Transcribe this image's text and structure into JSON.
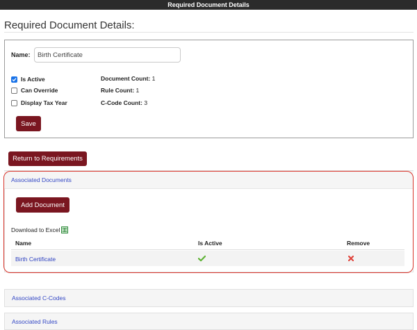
{
  "window": {
    "title": "Required Document Details"
  },
  "page": {
    "title": "Required Document Details:"
  },
  "form": {
    "name_label": "Name:",
    "name_value": "Birth Certificate",
    "checkboxes": [
      {
        "label": "Is Active",
        "checked": true
      },
      {
        "label": "Can Override",
        "checked": false
      },
      {
        "label": "Display Tax Year",
        "checked": false
      }
    ],
    "stats": [
      {
        "label": "Document Count:",
        "value": "1"
      },
      {
        "label": "Rule Count:",
        "value": "1"
      },
      {
        "label": "C-Code Count:",
        "value": "3"
      }
    ],
    "save_label": "Save"
  },
  "return_label": "Return to Requirements",
  "associated_documents": {
    "header": "Associated Documents",
    "add_label": "Add Document",
    "download_label": "Download to Excel",
    "columns": [
      "Name",
      "Is Active",
      "Remove"
    ],
    "rows": [
      {
        "name": "Birth Certificate",
        "is_active": true
      }
    ]
  },
  "associated_ccodes": {
    "header": "Associated C-Codes"
  },
  "associated_rules": {
    "header": "Associated Rules"
  },
  "colors": {
    "accent_button": "#7a1620",
    "link": "#3448c5",
    "highlight": "#d9342b",
    "active_check": "#5fb336",
    "remove_x": "#e0443c"
  }
}
